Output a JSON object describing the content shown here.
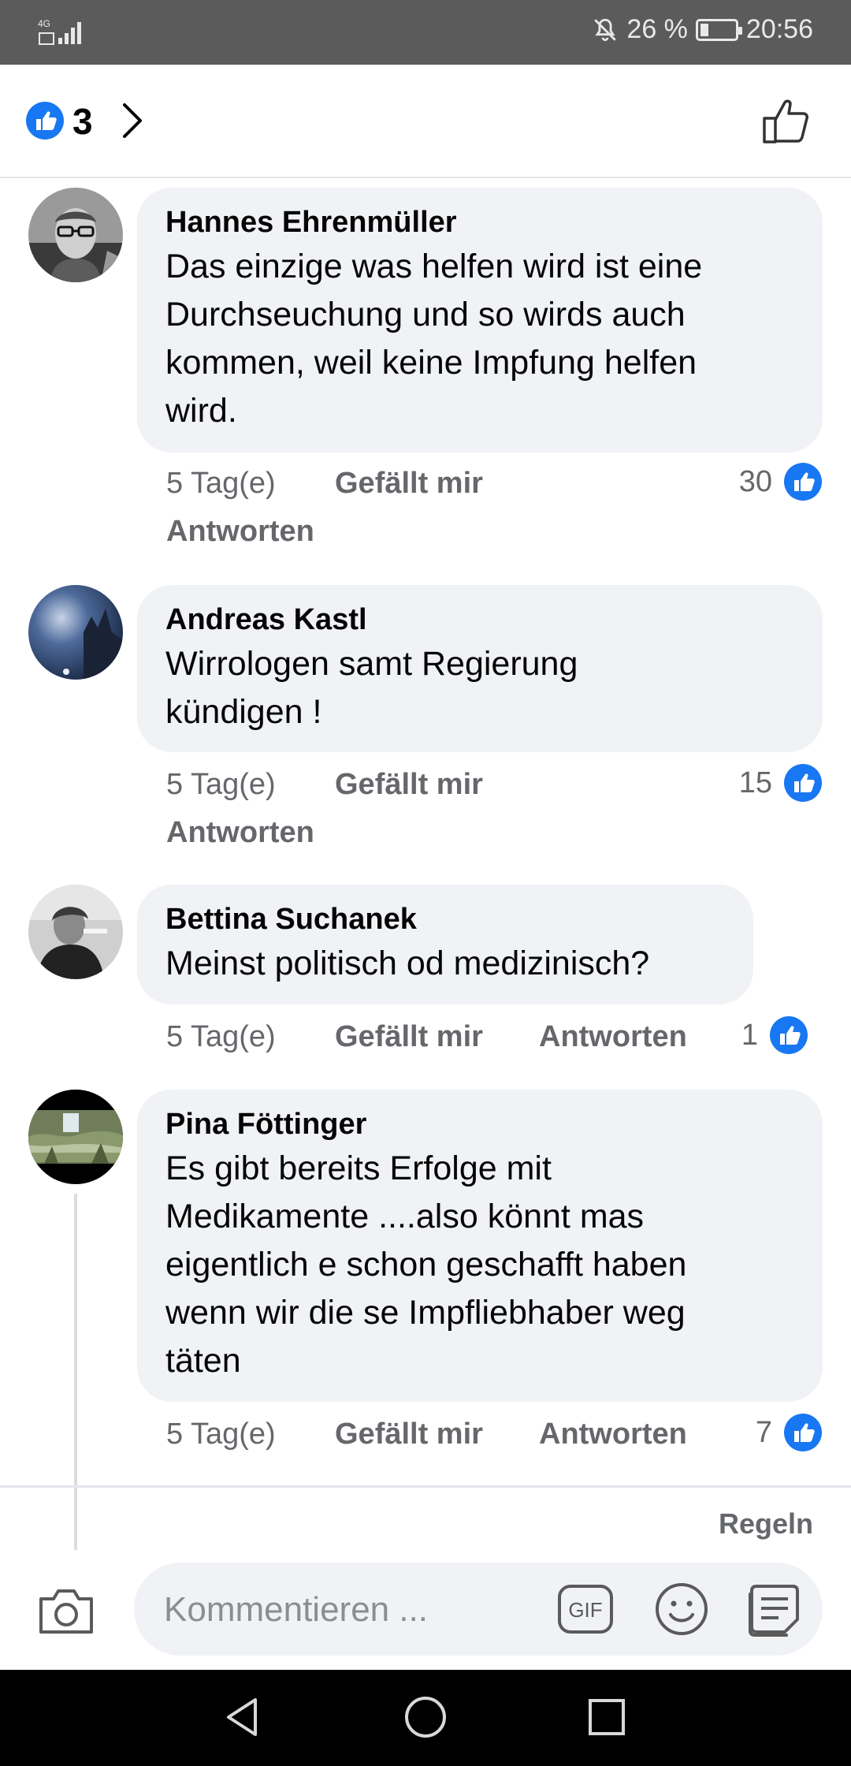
{
  "status_bar": {
    "network": "4G",
    "battery_percent": "26 %",
    "time": "20:56"
  },
  "header": {
    "reaction_count": "3"
  },
  "comments": [
    {
      "author": "Hannes Ehrenmüller",
      "text": "Das einzige was helfen wird ist eine\nDurchseuchung und so wirds auch\nkommen, weil keine Impfung helfen\nwird.",
      "time": "5 Tag(e)",
      "like_label": "Gefällt mir",
      "reply_label": "Antworten",
      "likes": "30"
    },
    {
      "author": "Andreas Kastl",
      "text": "Wirrologen samt Regierung\nkündigen !",
      "time": "5 Tag(e)",
      "like_label": "Gefällt mir",
      "reply_label": "Antworten",
      "likes": "15"
    },
    {
      "author": "Bettina Suchanek",
      "text": "Meinst politisch od medizinisch?",
      "time": "5 Tag(e)",
      "like_label": "Gefällt mir",
      "reply_label": "Antworten",
      "likes": "1"
    },
    {
      "author": "Pina Föttinger",
      "text": "Es gibt bereits Erfolge mit\nMedikamente ....also könnt mas\neigentlich e schon geschafft haben\nwenn wir die  se Impfliebhaber weg\ntäten",
      "time": "5 Tag(e)",
      "like_label": "Gefällt mir",
      "reply_label": "Antworten",
      "likes": "7"
    }
  ],
  "footer": {
    "rules_label": "Regeln",
    "composer_placeholder": "Kommentieren ...",
    "gif_label": "GIF"
  },
  "colors": {
    "like_blue": "#1877f2",
    "bubble_bg": "#f0f2f5",
    "meta_gray": "#65676b"
  }
}
